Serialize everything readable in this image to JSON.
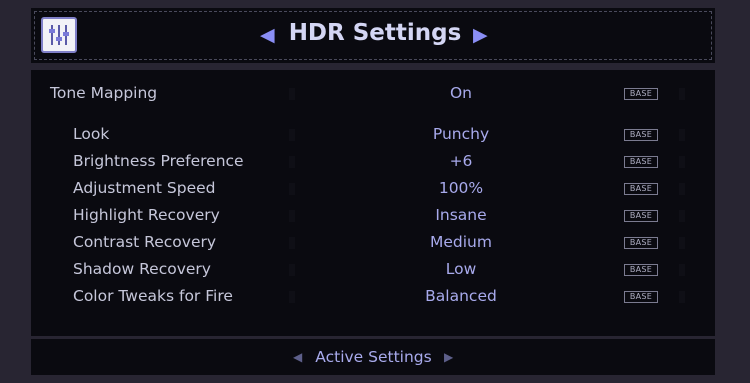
{
  "header": {
    "title": "HDR Settings",
    "icon": "sliders-icon",
    "prev_arrow": "◀",
    "next_arrow": "▶"
  },
  "rows": [
    {
      "label": "Tone Mapping",
      "value": "On",
      "badge": "BASE"
    },
    {
      "label": "Look",
      "value": "Punchy",
      "badge": "BASE"
    },
    {
      "label": "Brightness Preference",
      "value": "+6",
      "badge": "BASE"
    },
    {
      "label": "Adjustment Speed",
      "value": "100%",
      "badge": "BASE"
    },
    {
      "label": "Highlight Recovery",
      "value": "Insane",
      "badge": "BASE"
    },
    {
      "label": "Contrast Recovery",
      "value": "Medium",
      "badge": "BASE"
    },
    {
      "label": "Shadow Recovery",
      "value": "Low",
      "badge": "BASE"
    },
    {
      "label": "Color Tweaks for Fire",
      "value": "Balanced",
      "badge": "BASE"
    }
  ],
  "footer": {
    "label": "Active Settings",
    "prev_arrow": "◀",
    "next_arrow": "▶"
  },
  "colors": {
    "background": "#282532",
    "panel": "#0a0a10",
    "accent": "#8a8ef5",
    "value_text": "#a8aaec"
  }
}
